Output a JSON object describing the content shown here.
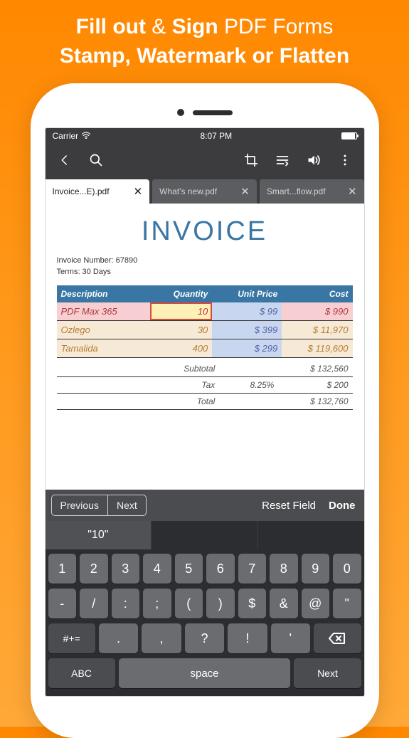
{
  "headline": {
    "line1_b1": "Fill out",
    "line1_amp": " & ",
    "line1_b2": "Sign",
    "line1_rest": " PDF Forms",
    "line2": "Stamp, Watermark or Flatten"
  },
  "statusbar": {
    "carrier": "Carrier",
    "time": "8:07 PM"
  },
  "tabs": [
    {
      "label": "Invoice...E).pdf",
      "active": true
    },
    {
      "label": "What's new.pdf",
      "active": false
    },
    {
      "label": "Smart...flow.pdf",
      "active": false
    }
  ],
  "invoice": {
    "title": "INVOICE",
    "meta1": "Invoice Number: 67890",
    "meta2": "Terms: 30 Days",
    "headers": {
      "desc": "Description",
      "qty": "Quantity",
      "unit": "Unit Price",
      "cost": "Cost"
    },
    "rows": [
      {
        "desc": "PDF Max 365",
        "qty": "10",
        "unit": "$ 99",
        "cost": "$ 990"
      },
      {
        "desc": "Ozlego",
        "qty": "30",
        "unit": "$ 399",
        "cost": "$ 11,970"
      },
      {
        "desc": "Tamalida",
        "qty": "400",
        "unit": "$ 299",
        "cost": "$ 119,600"
      }
    ],
    "totals": {
      "subtotal_lbl": "Subtotal",
      "subtotal_val": "$ 132,560",
      "tax_lbl": "Tax",
      "tax_pct": "8.25%",
      "tax_val": "$ 200",
      "total_lbl": "Total",
      "total_val": "$ 132,760"
    }
  },
  "formbar": {
    "prev": "Previous",
    "next": "Next",
    "reset": "Reset Field",
    "done": "Done"
  },
  "suggest": {
    "s0": "\"10\"",
    "s1": "",
    "s2": ""
  },
  "keys": {
    "r1": [
      "1",
      "2",
      "3",
      "4",
      "5",
      "6",
      "7",
      "8",
      "9",
      "0"
    ],
    "r2": [
      "-",
      "/",
      ":",
      ";",
      "(",
      ")",
      "$",
      "&",
      "@",
      "\""
    ],
    "shift": "#+=",
    "r3": [
      ".",
      ",",
      "?",
      "!",
      "'"
    ],
    "abc": "ABC",
    "space": "space",
    "next": "Next"
  }
}
